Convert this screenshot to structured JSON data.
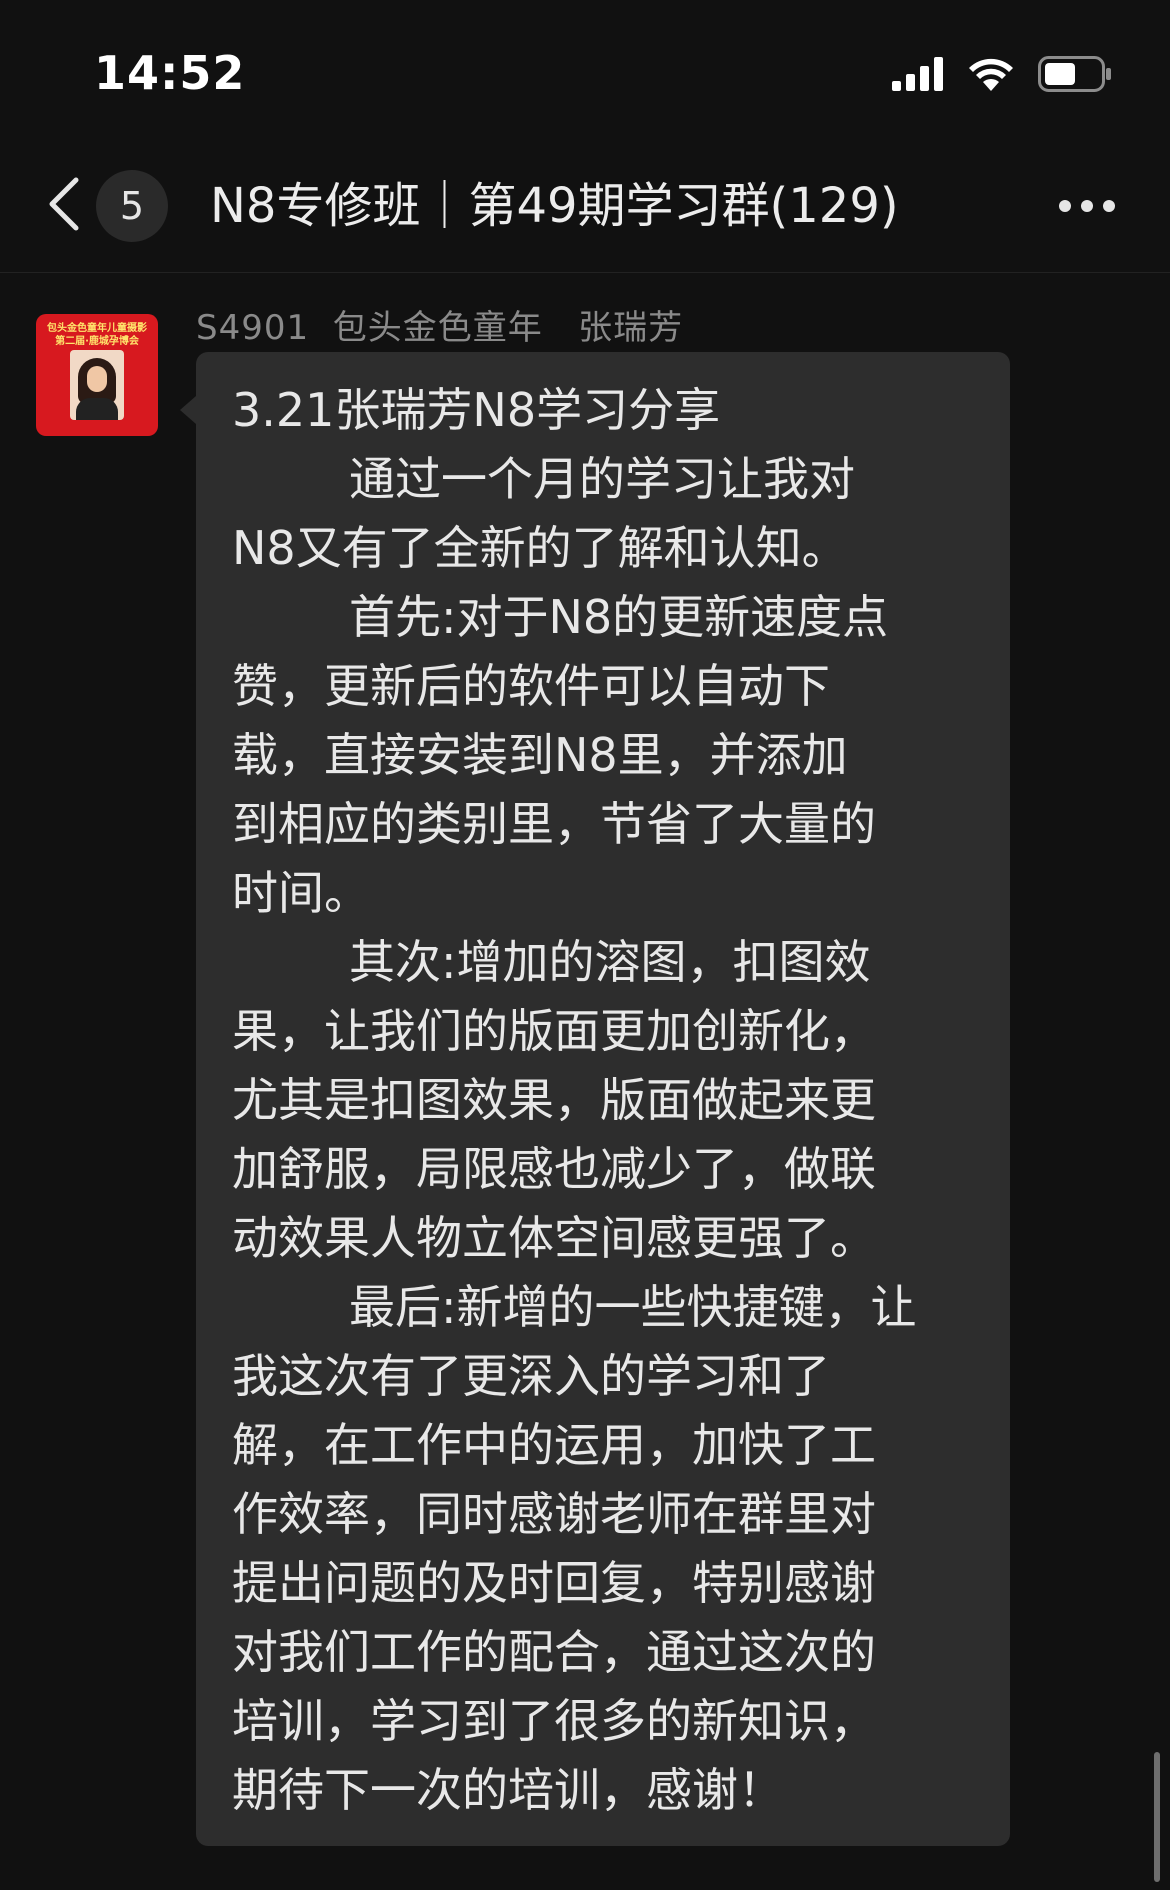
{
  "status_bar": {
    "time": "14:52"
  },
  "header": {
    "back_badge": "5",
    "title": "N8专修班｜第49期学习群(129)"
  },
  "message": {
    "sender": "S4901  包头金色童年   张瑞芳",
    "avatar_text": {
      "banner_line1": "包头金色童年儿童摄影",
      "banner_line2": "第二届·鹿城孕博会"
    },
    "lines": [
      "3.21张瑞芳N8学习分享",
      "        通过一个月的学习让我对",
      "N8又有了全新的了解和认知。",
      "        首先:对于N8的更新速度点",
      "赞，更新后的软件可以自动下",
      "载，直接安装到N8里，并添加",
      "到相应的类别里，节省了大量的",
      "时间。",
      "        其次:增加的溶图，扣图效",
      "果，让我们的版面更加创新化，",
      "尤其是扣图效果，版面做起来更",
      "加舒服，局限感也减少了，做联",
      "动效果人物立体空间感更强了。",
      "        最后:新增的一些快捷键，让",
      "我这次有了更深入的学习和了",
      "解，在工作中的运用，加快了工",
      "作效率，同时感谢老师在群里对",
      "提出问题的及时回复，特别感谢",
      "对我们工作的配合，通过这次的",
      "培训，学习到了很多的新知识，",
      "期待下一次的培训，感谢！"
    ]
  },
  "theme": {
    "background": "#111111",
    "bubble": "#2d2d2d",
    "text": "#e8e8e8",
    "muted": "#8a8a8a"
  },
  "icons": {
    "back": "chevron-left-icon",
    "signal": "cellular-signal-icon",
    "wifi": "wifi-icon",
    "battery": "battery-icon",
    "more": "more-icon"
  }
}
